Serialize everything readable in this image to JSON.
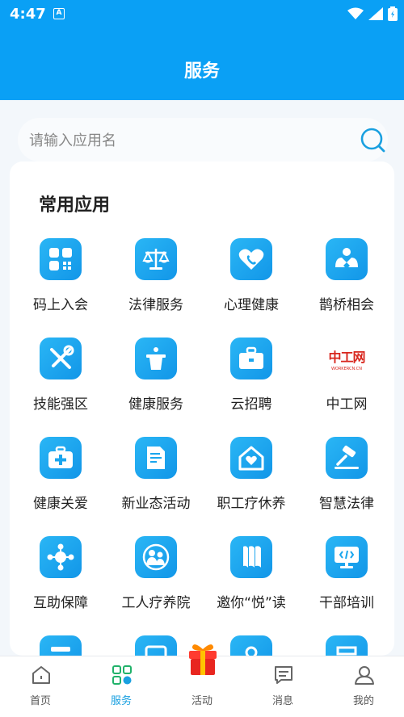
{
  "status": {
    "time": "4:47",
    "notif_glyph": "A"
  },
  "header": {
    "title": "服务"
  },
  "search": {
    "placeholder": "请输入应用名"
  },
  "section": {
    "title": "常用应用"
  },
  "apps": [
    {
      "label": "码上入会",
      "icon": "grid-scan-icon"
    },
    {
      "label": "法律服务",
      "icon": "scales-icon"
    },
    {
      "label": "心理健康",
      "icon": "heart-phone-icon"
    },
    {
      "label": "鹊桥相会",
      "icon": "couple-icon"
    },
    {
      "label": "技能强区",
      "icon": "tools-icon"
    },
    {
      "label": "健康服务",
      "icon": "podium-icon"
    },
    {
      "label": "云招聘",
      "icon": "briefcase-icon"
    },
    {
      "label": "中工网",
      "icon": "zhonggongwang-logo",
      "logo_text": "中工网",
      "logo_sub": "WORKERCN.CN"
    },
    {
      "label": "健康关爱",
      "icon": "medical-kit-icon"
    },
    {
      "label": "新业态活动",
      "icon": "document-icon"
    },
    {
      "label": "职工疗休养",
      "icon": "house-heart-icon"
    },
    {
      "label": "智慧法律",
      "icon": "gavel-icon"
    },
    {
      "label": "互助保障",
      "icon": "network-icon"
    },
    {
      "label": "工人疗养院",
      "icon": "people-icon"
    },
    {
      "label": "邀你“悦”读",
      "icon": "book-icon"
    },
    {
      "label": "干部培训",
      "icon": "monitor-code-icon"
    }
  ],
  "tabs": [
    {
      "label": "首页",
      "icon": "home-icon"
    },
    {
      "label": "服务",
      "icon": "apps-grid-icon",
      "active": true
    },
    {
      "label": "活动",
      "icon": "gift-icon"
    },
    {
      "label": "消息",
      "icon": "message-icon"
    },
    {
      "label": "我的",
      "icon": "user-icon"
    }
  ],
  "colors": {
    "primary": "#0aa0f5",
    "icon_gradient_start": "#2ab6f5",
    "icon_gradient_end": "#1296e8",
    "logo_red": "#d8261d"
  }
}
